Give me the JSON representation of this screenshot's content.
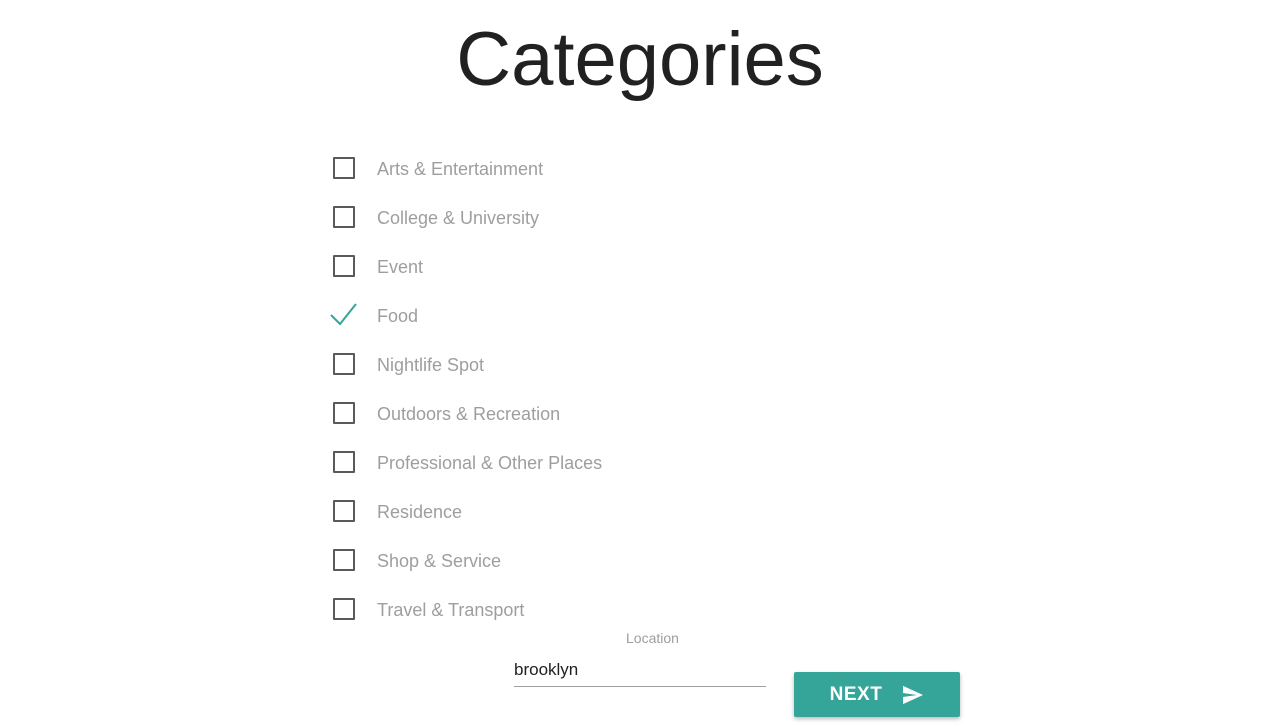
{
  "page": {
    "title": "Categories"
  },
  "categories": [
    {
      "label": "Arts & Entertainment",
      "checked": false
    },
    {
      "label": "College & University",
      "checked": false
    },
    {
      "label": "Event",
      "checked": false
    },
    {
      "label": "Food",
      "checked": true
    },
    {
      "label": "Nightlife Spot",
      "checked": false
    },
    {
      "label": "Outdoors & Recreation",
      "checked": false
    },
    {
      "label": "Professional & Other Places",
      "checked": false
    },
    {
      "label": "Residence",
      "checked": false
    },
    {
      "label": "Shop & Service",
      "checked": false
    },
    {
      "label": "Travel & Transport",
      "checked": false
    }
  ],
  "location": {
    "label": "Location",
    "value": "brooklyn"
  },
  "next_button": {
    "label": "NEXT",
    "icon": "send-icon"
  },
  "colors": {
    "accent": "#35a59a",
    "title_text": "#212121",
    "label_text": "#9e9e9e",
    "checkbox_border": "#5a5a5a"
  }
}
